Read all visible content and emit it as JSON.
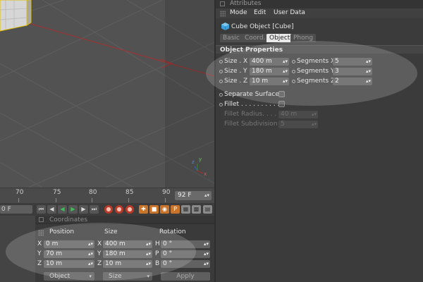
{
  "attributes": {
    "title": "Attributes",
    "menu": [
      "Mode",
      "Edit",
      "User Data"
    ],
    "object_title": "Cube Object [Cube]",
    "tabs": [
      {
        "label": "Basic",
        "active": false
      },
      {
        "label": "Coord.",
        "active": false
      },
      {
        "label": "Object",
        "active": true
      },
      {
        "label": "Phong",
        "active": false
      }
    ],
    "section": "Object Properties",
    "size_x_label": "Size . X",
    "size_x": "400 m",
    "size_y_label": "Size . Y",
    "size_y": "180 m",
    "size_z_label": "Size . Z",
    "size_z": "10 m",
    "seg_x_label": "Segments X",
    "seg_x": "5",
    "seg_y_label": "Segments Y",
    "seg_y": "3",
    "seg_z_label": "Segments Z",
    "seg_z": "2",
    "separate_surfaces_label": "Separate Surfaces",
    "separate_surfaces_checked": false,
    "fillet_label": "Fillet . . . . . . . . . . .",
    "fillet_checked": false,
    "fillet_radius_label": "Fillet Radius. . . . .",
    "fillet_radius": "40 m",
    "fillet_subdivision_label": "Fillet Subdivision",
    "fillet_subdivision": "5"
  },
  "timeline": {
    "ticks": [
      "70",
      "75",
      "80",
      "85",
      "90"
    ],
    "current_frame": "92 F",
    "start_frame": "0 F"
  },
  "coordinates": {
    "title": "Coordinates",
    "headers": [
      "Position",
      "Size",
      "Rotation"
    ],
    "pos_x": "0 m",
    "pos_y": "70 m",
    "pos_z": "10 m",
    "size_x": "400 m",
    "size_y": "180 m",
    "size_z": "10 m",
    "rot_h": "0 °",
    "rot_p": "0 °",
    "rot_b": "0 °",
    "axis_x": "X",
    "axis_y": "Y",
    "axis_z": "Z",
    "axis_h": "H",
    "axis_p": "P",
    "axis_b": "B",
    "mode_dropdown": "Object",
    "size_dropdown": "Size",
    "apply_label": "Apply"
  },
  "viewport": {
    "axis_z": "z",
    "axis_x": "x",
    "axis_y": "y"
  },
  "colors": {
    "background": "#3f3f3f",
    "viewport": "#525252",
    "field": "#5c5c5c",
    "accent_red": "#a83030",
    "active_tab": "#eaeaea"
  }
}
